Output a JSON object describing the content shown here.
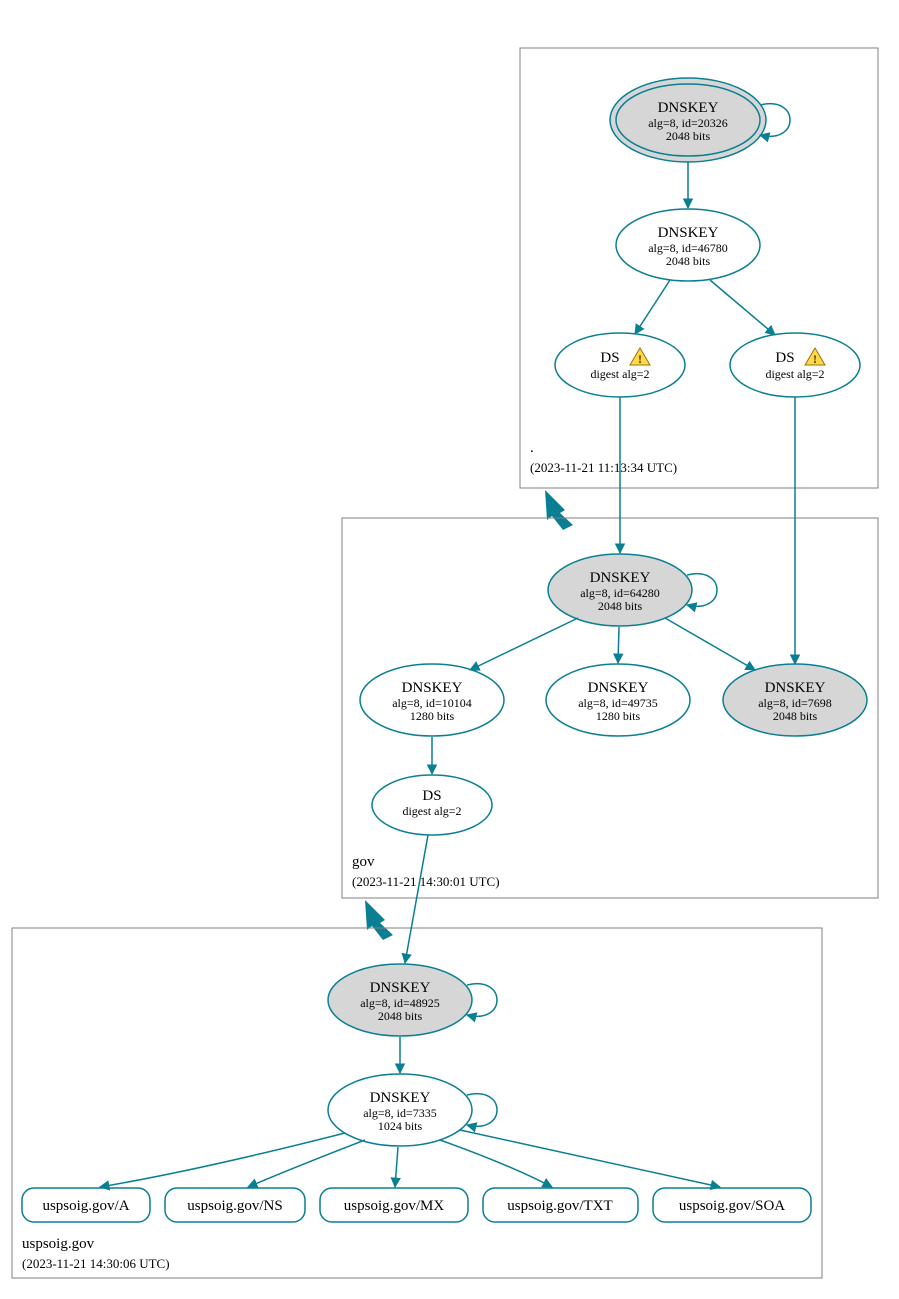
{
  "colors": {
    "teal": "#0a7f93",
    "grayFill": "#d6d6d6",
    "boxStroke": "#808080"
  },
  "zones": {
    "root": {
      "label": ".",
      "timestamp": "(2023-11-21 11:13:34 UTC)"
    },
    "gov": {
      "label": "gov",
      "timestamp": "(2023-11-21 14:30:01 UTC)"
    },
    "uspsoig": {
      "label": "uspsoig.gov",
      "timestamp": "(2023-11-21 14:30:06 UTC)"
    }
  },
  "nodes": {
    "root_ksk": {
      "title": "DNSKEY",
      "l1": "alg=8, id=20326",
      "l2": "2048 bits"
    },
    "root_zsk": {
      "title": "DNSKEY",
      "l1": "alg=8, id=46780",
      "l2": "2048 bits"
    },
    "ds1": {
      "title": "DS",
      "l1": "digest alg=2"
    },
    "ds2": {
      "title": "DS",
      "l1": "digest alg=2"
    },
    "gov_ksk": {
      "title": "DNSKEY",
      "l1": "alg=8, id=64280",
      "l2": "2048 bits"
    },
    "gov_zsk1": {
      "title": "DNSKEY",
      "l1": "alg=8, id=10104",
      "l2": "1280 bits"
    },
    "gov_zsk2": {
      "title": "DNSKEY",
      "l1": "alg=8, id=49735",
      "l2": "1280 bits"
    },
    "gov_key3": {
      "title": "DNSKEY",
      "l1": "alg=8, id=7698",
      "l2": "2048 bits"
    },
    "gov_ds": {
      "title": "DS",
      "l1": "digest alg=2"
    },
    "usp_ksk": {
      "title": "DNSKEY",
      "l1": "alg=8, id=48925",
      "l2": "2048 bits"
    },
    "usp_zsk": {
      "title": "DNSKEY",
      "l1": "alg=8, id=7335",
      "l2": "1024 bits"
    }
  },
  "leaves": {
    "a": "uspsoig.gov/A",
    "ns": "uspsoig.gov/NS",
    "mx": "uspsoig.gov/MX",
    "txt": "uspsoig.gov/TXT",
    "soa": "uspsoig.gov/SOA"
  }
}
